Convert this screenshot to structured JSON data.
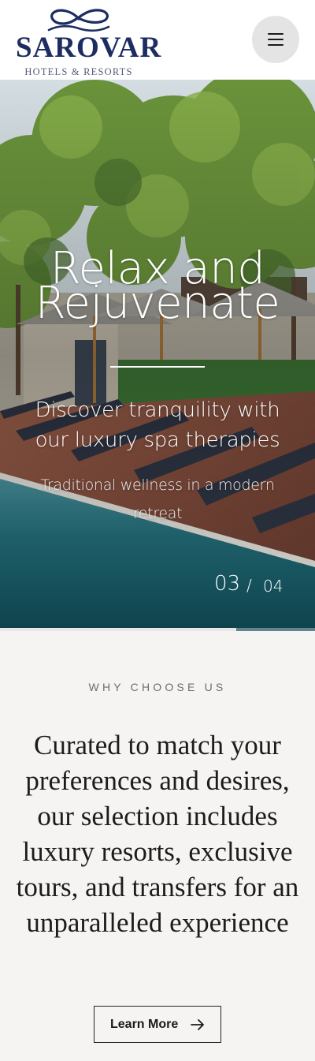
{
  "header": {
    "logo_word": "SAROVAR",
    "logo_sub": "HOTELS & RESORTS",
    "menu_icon": "hamburger-icon"
  },
  "hero": {
    "title": "Relax and Rejuvenate",
    "subtitle": "Discover tranquility with our luxury spa therapies",
    "description": "Traditional wellness in a modern retreat",
    "slide_current": "03",
    "slide_separator": "/",
    "slide_total": "04",
    "progress": 0.75
  },
  "why": {
    "label": "WHY CHOOSE US",
    "text": "Curated to match your preferences and desires, our selection includes luxury resorts, exclusive tours, and transfers for an unparalleled experience",
    "button_label": "Learn More",
    "button_icon": "arrow-right-icon"
  },
  "colors": {
    "brand_navy": "#1d2c61",
    "page_bg": "#f5f4f2",
    "menu_bg": "#e4e4e4"
  }
}
